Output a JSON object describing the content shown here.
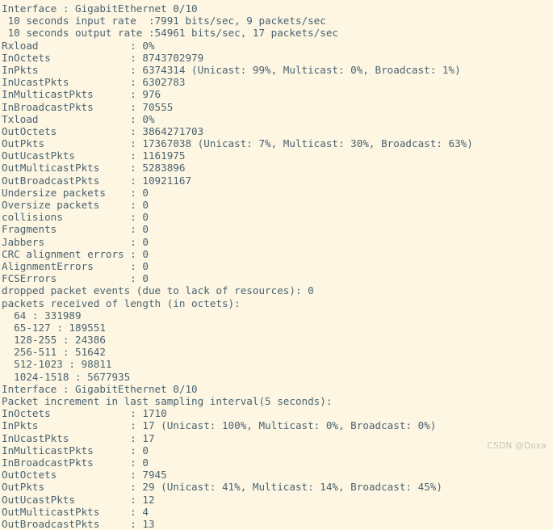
{
  "terminal": {
    "background_color": "#fdf6e3",
    "text_color": "#4a6370",
    "lines": [
      "Interface : GigabitEthernet 0/10",
      " 10 seconds input rate  :7991 bits/sec, 9 packets/sec",
      " 10 seconds output rate :54961 bits/sec, 17 packets/sec",
      "Rxload               : 0%",
      "InOctets             : 8743702979",
      "InPkts               : 6374314 (Unicast: 99%, Multicast: 0%, Broadcast: 1%)",
      "InUcastPkts          : 6302783",
      "InMulticastPkts      : 976",
      "InBroadcastPkts      : 70555",
      "Txload               : 0%",
      "OutOctets            : 3864271703",
      "OutPkts              : 17367038 (Unicast: 7%, Multicast: 30%, Broadcast: 63%)",
      "OutUcastPkts         : 1161975",
      "OutMulticastPkts     : 5283896",
      "OutBroadcastPkts     : 10921167",
      "Undersize packets    : 0",
      "Oversize packets     : 0",
      "collisions           : 0",
      "Fragments            : 0",
      "Jabbers              : 0",
      "CRC alignment errors : 0",
      "AlignmentErrors      : 0",
      "FCSErrors            : 0",
      "dropped packet events (due to lack of resources): 0",
      "packets received of length (in octets):",
      "  64 : 331989",
      "  65-127 : 189551",
      "  128-255 : 24386",
      "  256-511 : 51642",
      "  512-1023 : 98811",
      "  1024-1518 : 5677935",
      "Interface : GigabitEthernet 0/10",
      "Packet increment in last sampling interval(5 seconds):",
      "InOctets             : 1710",
      "InPkts               : 17 (Unicast: 100%, Multicast: 0%, Broadcast: 0%)",
      "InUcastPkts          : 17",
      "InMulticastPkts      : 0",
      "InBroadcastPkts      : 0",
      "OutOctets            : 7945",
      "OutPkts              : 29 (Unicast: 41%, Multicast: 14%, Broadcast: 45%)",
      "OutUcastPkts         : 12",
      "OutMulticastPkts     : 4",
      "OutBroadcastPkts     : 13"
    ]
  },
  "watermark": {
    "text": "CSDN @Doxa",
    "color": "#c8c3b4"
  }
}
